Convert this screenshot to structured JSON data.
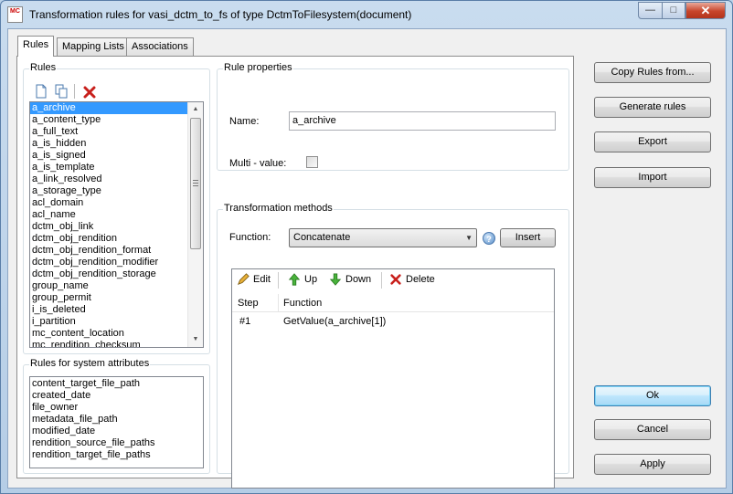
{
  "window": {
    "title": "Transformation rules for vasi_dctm_to_fs of type DctmToFilesystem(document)",
    "app_icon_text": "MC",
    "controls": {
      "minimize": "—",
      "maximize": "□",
      "close": "✕"
    }
  },
  "tabs": [
    {
      "label": "Rules"
    },
    {
      "label": "Mapping Lists"
    },
    {
      "label": "Associations"
    }
  ],
  "rules": {
    "group_label": "Rules",
    "items": [
      "a_archive",
      "a_content_type",
      "a_full_text",
      "a_is_hidden",
      "a_is_signed",
      "a_is_template",
      "a_link_resolved",
      "a_storage_type",
      "acl_domain",
      "acl_name",
      "dctm_obj_link",
      "dctm_obj_rendition",
      "dctm_obj_rendition_format",
      "dctm_obj_rendition_modifier",
      "dctm_obj_rendition_storage",
      "group_name",
      "group_permit",
      "i_is_deleted",
      "i_partition",
      "mc_content_location",
      "mc_rendition_checksum"
    ],
    "selected": "a_archive"
  },
  "system_rules": {
    "group_label": "Rules for system attributes",
    "items": [
      "content_target_file_path",
      "created_date",
      "file_owner",
      "metadata_file_path",
      "modified_date",
      "rendition_source_file_paths",
      "rendition_target_file_paths"
    ]
  },
  "rule_properties": {
    "group_label": "Rule properties",
    "name_label": "Name:",
    "name_value": "a_archive",
    "multi_value_label": "Multi - value:",
    "multi_value_checked": false
  },
  "transformation": {
    "group_label": "Transformation methods",
    "function_label": "Function:",
    "function_value": "Concatenate",
    "insert_label": "Insert",
    "toolbar": {
      "edit": "Edit",
      "up": "Up",
      "down": "Down",
      "delete": "Delete"
    },
    "columns": [
      "Step",
      "Function"
    ],
    "rows": [
      {
        "step": "#1",
        "function": "GetValue(a_archive[1])"
      }
    ]
  },
  "side_buttons": {
    "copy_rules": "Copy Rules from...",
    "generate_rules": "Generate rules",
    "export": "Export",
    "import": "Import",
    "ok": "Ok",
    "cancel": "Cancel",
    "apply": "Apply"
  },
  "colors": {
    "selection": "#3399ff",
    "title_bar": "#c9dcef",
    "close_button": "#c7442a"
  }
}
